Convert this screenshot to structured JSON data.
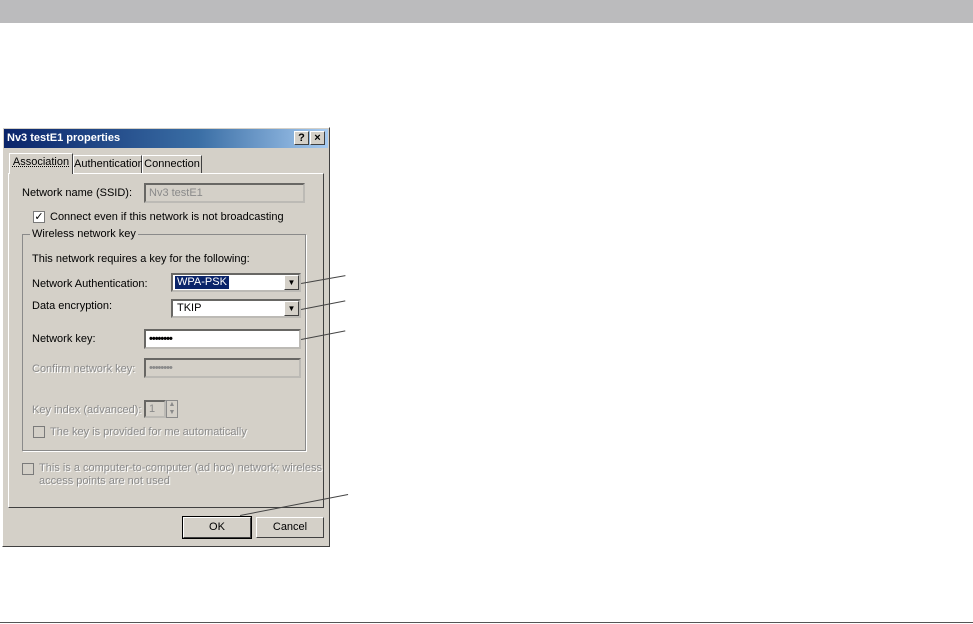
{
  "dialog": {
    "title": "Nv3 testE1 properties",
    "help_button": "?",
    "close_button": "×"
  },
  "tabs": [
    {
      "label": "Association",
      "active": true
    },
    {
      "label": "Authentication",
      "active": false
    },
    {
      "label": "Connection",
      "active": false
    }
  ],
  "association": {
    "ssid_label": "Network name (SSID):",
    "ssid_value": "Nv3 testE1",
    "broadcast_checkbox_label": "Connect even if this network is not broadcasting",
    "broadcast_checked": true,
    "group_title": "Wireless network key",
    "requires_text": "This network requires a key for the following:",
    "auth_label": "Network Authentication:",
    "auth_value": "WPA-PSK",
    "encryption_label": "Data encryption:",
    "encryption_value": "TKIP",
    "network_key_label": "Network key:",
    "network_key_value": "••••••••",
    "confirm_key_label": "Confirm network key:",
    "confirm_key_value": "••••••••",
    "key_index_label": "Key index (advanced):",
    "key_index_value": "1",
    "auto_key_label": "The key is provided for me automatically",
    "adhoc_label_line1": "This is a computer-to-computer (ad hoc) network; wireless",
    "adhoc_label_line2": "access points are not used"
  },
  "buttons": {
    "ok": "OK",
    "cancel": "Cancel"
  },
  "icons": {
    "check": "✓",
    "dropdown": "▼",
    "spin_up": "▲",
    "spin_down": "▼"
  }
}
